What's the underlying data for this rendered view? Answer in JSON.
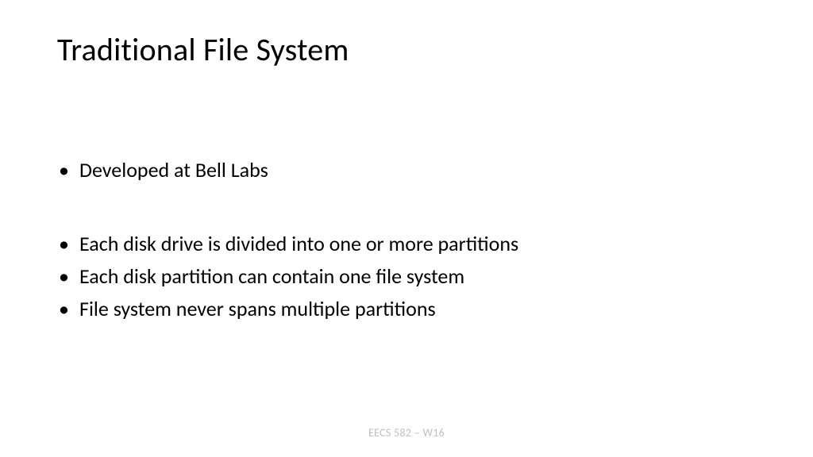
{
  "slide": {
    "title": "Traditional File System",
    "bullets": [
      {
        "text": "Developed at Bell Labs",
        "gap_after": true
      },
      {
        "text": "Each disk drive is divided into one or more partitions",
        "gap_after": false
      },
      {
        "text": "Each disk partition can contain one file system",
        "gap_after": false
      },
      {
        "text": "File system never spans multiple partitions",
        "gap_after": false
      }
    ],
    "footer": "EECS 582 – W16"
  }
}
